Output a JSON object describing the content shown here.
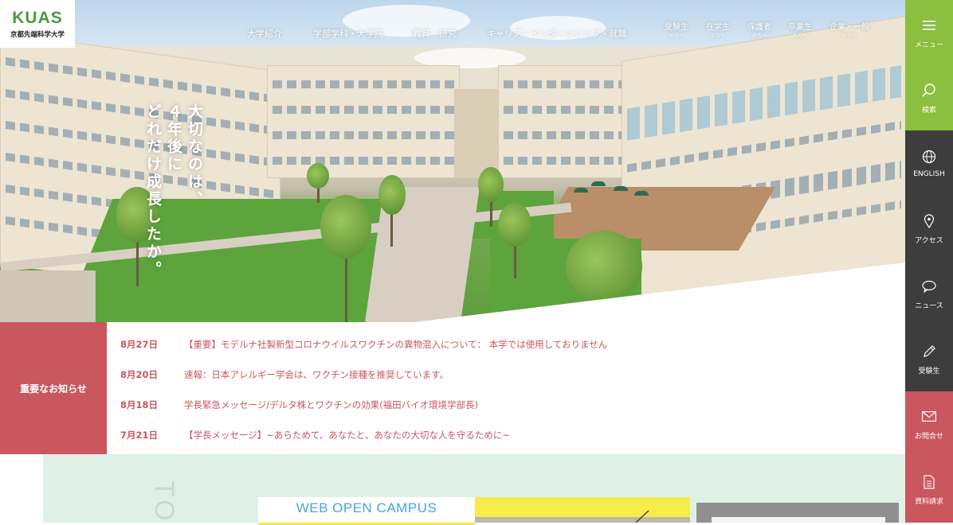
{
  "logo": {
    "mark": "KUAS",
    "name": "京都先端科学大学"
  },
  "nav": {
    "main": [
      "大学紹介",
      "学部学科・大学院",
      "教育・研究",
      "キャリア・インターンシップ・就職"
    ],
    "audience": [
      {
        "label": "受験生",
        "sub": "の方へ"
      },
      {
        "label": "在学生",
        "sub": "の方へ"
      },
      {
        "label": "保護者",
        "sub": "の方へ"
      },
      {
        "label": "卒業生",
        "sub": "の方へ"
      },
      {
        "label": "企業・一般",
        "sub": "の方へ"
      }
    ]
  },
  "hero": {
    "catch_lines": [
      "大切なのは、",
      "４年後に",
      "どれだけ成長したか。"
    ]
  },
  "news": {
    "heading": "重要なお知らせ",
    "items": [
      {
        "date": "8月27日",
        "title": "【重要】モデルナ社製新型コロナウイルスワクチンの異物混入について： 本学では使用しておりません"
      },
      {
        "date": "8月20日",
        "title": "速報：日本アレルギー学会は、ワクチン接種を推奨しています。"
      },
      {
        "date": "8月18日",
        "title": "学長緊急メッセージ/デルタ株とワクチンの効果(福田バイオ環境学部長)"
      },
      {
        "date": "7月21日",
        "title": "【学長メッセージ】~あらためて、あなたと、あなたの大切な人を守るために~"
      }
    ]
  },
  "campus": {
    "web_open_campus": "WEB OPEN CAMPUS",
    "vertical_text": "TO"
  },
  "sidebar": [
    {
      "label": "メニュー",
      "icon": "menu-icon",
      "bg": "#8bbf3f"
    },
    {
      "label": "検索",
      "icon": "search-icon",
      "bg": "#8bbf3f"
    },
    {
      "label": "ENGLISH",
      "icon": "globe-icon",
      "bg": "#3d3d3d"
    },
    {
      "label": "アクセス",
      "icon": "map-pin-icon",
      "bg": "#3d3d3d"
    },
    {
      "label": "ニュース",
      "icon": "chat-icon",
      "bg": "#3d3d3d"
    },
    {
      "label": "受験生",
      "icon": "pencil-icon",
      "bg": "#3d3d3d"
    },
    {
      "label": "お問合せ",
      "icon": "mail-icon",
      "bg": "#c9575d"
    },
    {
      "label": "資料請求",
      "icon": "document-icon",
      "bg": "#c9575d"
    }
  ],
  "colors": {
    "accent_green": "#8bbf3f",
    "accent_red": "#c9575d",
    "sidebar_dark": "#3d3d3d",
    "mint": "#dff1e6"
  }
}
